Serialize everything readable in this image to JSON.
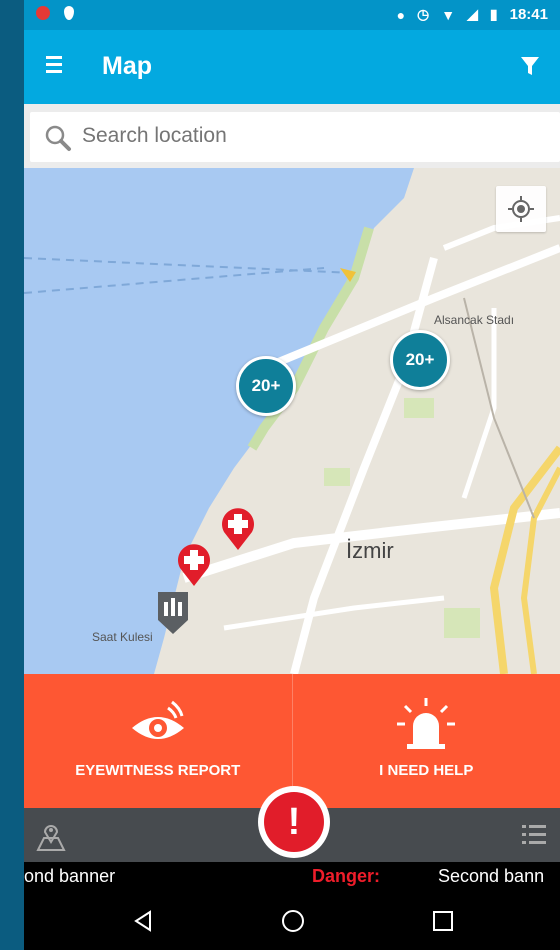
{
  "status_bar": {
    "time": "18:41"
  },
  "app_bar": {
    "title": "Map"
  },
  "search": {
    "placeholder": "Search location"
  },
  "map": {
    "clusters": [
      {
        "label": "20+"
      },
      {
        "label": "20+"
      }
    ],
    "labels": {
      "stadium": "Alsancak Stadı",
      "city": "İzmir",
      "clock_tower": "Saat Kulesi"
    },
    "colors": {
      "water": "#a8c9f2",
      "land": "#e9e5dc",
      "marker": "#e11d2a",
      "cluster": "#0f7f99"
    }
  },
  "actions": {
    "eyewitness_label": "EYEWITNESS REPORT",
    "help_label": "I NEED HELP",
    "color": "#fe5733"
  },
  "ticker": {
    "left_text": "ond banner",
    "danger_text": "Danger:",
    "right_text": "Second bann"
  },
  "icons": [
    "menu-icon",
    "filter-icon",
    "search-icon",
    "locate-icon",
    "eye-icon",
    "alarm-icon",
    "map-marker-icon",
    "list-icon",
    "danger-icon",
    "back-icon",
    "home-icon",
    "recents-icon"
  ]
}
